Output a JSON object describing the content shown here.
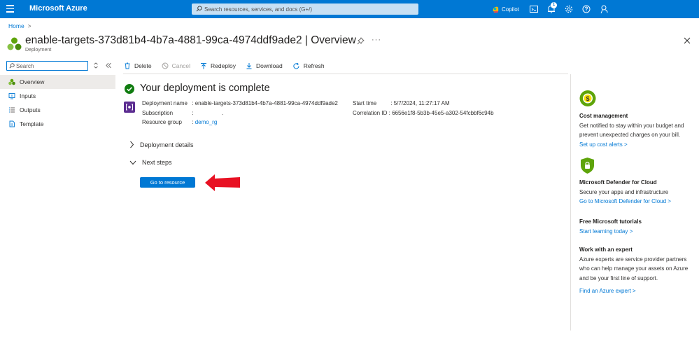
{
  "topbar": {
    "brand": "Microsoft Azure",
    "search_placeholder": "Search resources, services, and docs (G+/)",
    "copilot_label": "Copilot",
    "notification_count": "1"
  },
  "header": {
    "breadcrumb_home": "Home",
    "breadcrumb_sep": ">",
    "title": "enable-targets-373d81b4-4b7a-4881-99ca-4974ddf9ade2 | Overview",
    "subtitle": "Deployment"
  },
  "nav": {
    "search_placeholder": "Search",
    "items": [
      {
        "label": "Overview"
      },
      {
        "label": "Inputs"
      },
      {
        "label": "Outputs"
      },
      {
        "label": "Template"
      }
    ]
  },
  "toolbar": {
    "delete": "Delete",
    "cancel": "Cancel",
    "redeploy": "Redeploy",
    "download": "Download",
    "refresh": "Refresh"
  },
  "main": {
    "heading": "Your deployment is complete",
    "details_left": [
      {
        "key": "Deployment name",
        "sep": ":",
        "value": "enable-targets-373d81b4-4b7a-4881-99ca-4974ddf9ade2"
      },
      {
        "key": "Subscription",
        "sep": ":",
        "value": "."
      },
      {
        "key": "Resource group",
        "sep": ":",
        "value": "demo_rg"
      }
    ],
    "details_right": [
      {
        "key": "Start time",
        "sep": ":",
        "value": "5/7/2024, 11:27:17 AM"
      },
      {
        "key": "Correlation ID",
        "sep": ":",
        "value": "6656e1f8-5b3b-45e5-a302-54fcbbf6c94b"
      }
    ],
    "deployment_details": "Deployment details",
    "next_steps": "Next steps",
    "go_to_resource": "Go to resource"
  },
  "right_panel": {
    "cost": {
      "title": "Cost management",
      "text1": "Get notified to stay within your budget and",
      "text2": "prevent unexpected charges on your bill.",
      "link": "Set up cost alerts >"
    },
    "defender": {
      "title": "Microsoft Defender for Cloud",
      "text1": "Secure your apps and infrastructure",
      "link": "Go to Microsoft Defender for Cloud >"
    },
    "tutorials": {
      "title": "Free Microsoft tutorials",
      "link": "Start learning today >"
    },
    "expert": {
      "title": "Work with an expert",
      "text1": "Azure experts are service provider partners",
      "text2": "who can help manage your assets on Azure",
      "text3": "and be your first line of support.",
      "link": "Find an Azure expert >"
    }
  },
  "colors": {
    "accent": "#0078d4",
    "success": "#107c10",
    "arrow": "#e81123"
  }
}
